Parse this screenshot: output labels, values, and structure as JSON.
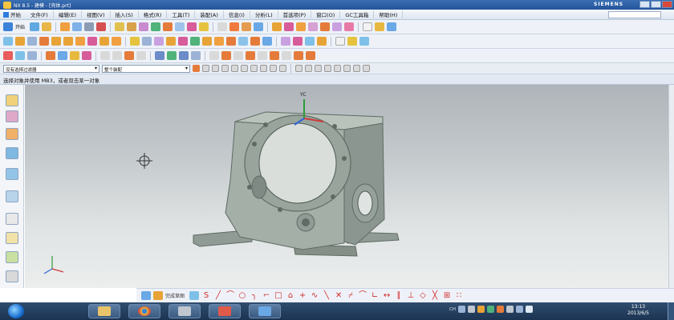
{
  "window": {
    "title": "NX 8.5 - 建模 - [壳体.prt]",
    "brand": "SIEMENS"
  },
  "menubar": {
    "start_label": "开始",
    "items": [
      "文件(F)",
      "编辑(E)",
      "视图(V)",
      "插入(S)",
      "格式(R)",
      "工具(T)",
      "装配(A)",
      "信息(I)",
      "分析(L)",
      "首选项(P)",
      "窗口(O)",
      "GC工具箱",
      "帮助(H)"
    ]
  },
  "toolbar1": {
    "start_button_label": "开始"
  },
  "selection_bar": {
    "filter_value": "没有选择过滤器",
    "scope_value": "整个装配"
  },
  "cue_line": {
    "text": "选择对象并使用 MB3，或者双击某一对象"
  },
  "viewport": {
    "wcs_axis_label": "YC",
    "model": "gearbox housing",
    "colors": {
      "model": "#9aa79f",
      "background_top": "#aeb4b9",
      "background_bottom": "#eceeee"
    }
  },
  "sketch_toolbar": {
    "label": "完成草图"
  },
  "taskbar": {
    "clock_time": "13:13",
    "clock_date": "2013/6/5",
    "language": "CH"
  },
  "icons": {
    "resource_bar": [
      "assembly-navigator-icon",
      "constraint-navigator-icon",
      "part-navigator-icon",
      "reuse-library-icon",
      "web-browser-icon",
      "history-icon",
      "system-materials-icon",
      "process-studio-icon",
      "roles-icon",
      "system-scenes-icon"
    ]
  }
}
